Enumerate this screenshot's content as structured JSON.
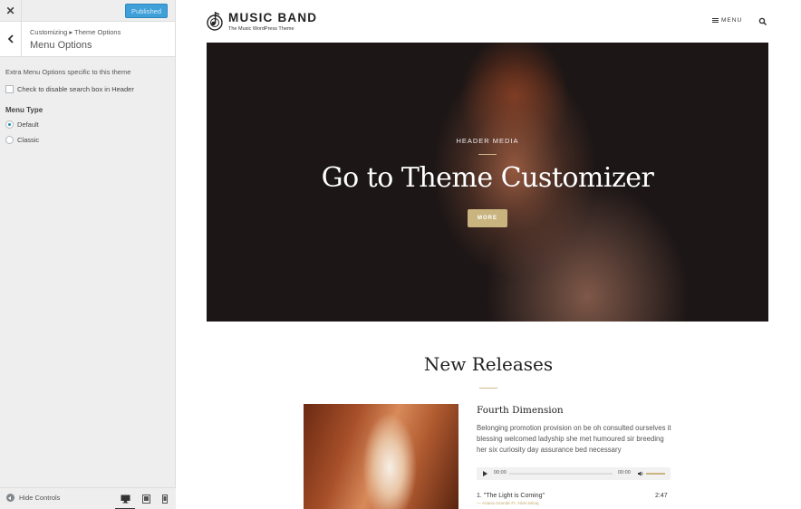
{
  "customizer": {
    "close_label": "✕",
    "publish_label": "Published",
    "breadcrumb": "Customizing ▸ Theme Options",
    "section_title": "Menu Options",
    "description": "Extra Menu Options specific to this theme",
    "disable_search_label": "Check to disable search box in Header",
    "menu_type_title": "Menu Type",
    "menu_type_options": [
      "Default",
      "Classic"
    ],
    "menu_type_selected": "Default",
    "hide_controls_label": "Hide Controls",
    "devices": [
      "desktop",
      "tablet",
      "mobile"
    ],
    "active_device": "desktop"
  },
  "site": {
    "title": "MUSIC BAND",
    "tagline": "The Music WordPress Theme",
    "menu_label": "MENU",
    "hero": {
      "kicker": "HEADER MEDIA",
      "title": "Go to Theme Customizer",
      "button_label": "MORE"
    },
    "releases": {
      "heading": "New Releases",
      "album_title": "Fourth Dimension",
      "description": "Belonging promotion provision on be oh consulted ourselves it blessing welcomed ladyship she met humoured sir breeding her six curiosity day assurance bed necessary",
      "player": {
        "current_time": "00:00",
        "duration": "00:00"
      },
      "track": {
        "title": "1. \"The Light is Coming\"",
        "length": "2:47",
        "artist": "— Ariana Grande Ft. Nicki Minaj"
      }
    }
  },
  "colors": {
    "accent_gold": "#c9b47f",
    "publish_blue": "#3e9fd9",
    "sidebar_bg": "#eeeeee"
  }
}
